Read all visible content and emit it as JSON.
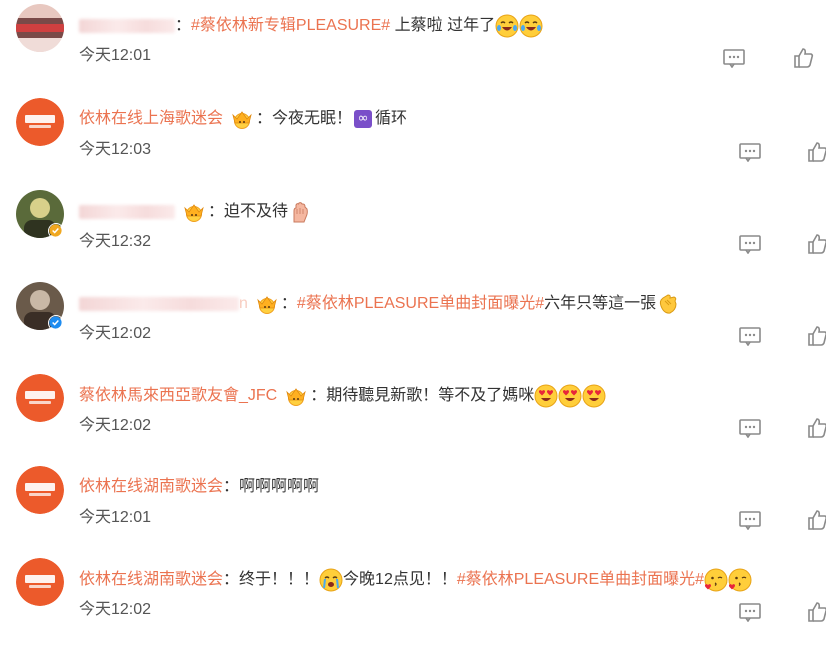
{
  "colors": {
    "accent": "#eb7350",
    "text": "#333333",
    "time": "#555555",
    "icon": "#8a8a8a"
  },
  "comments": [
    {
      "user": {
        "name": "",
        "name_blurred": true,
        "crown": false,
        "verified": false,
        "avatar": "blurred-avatar"
      },
      "colon": "：",
      "content": [
        {
          "type": "hashtag",
          "text": "#蔡依林新专辑PLEASURE#"
        },
        {
          "type": "text",
          "text": " 上蔡啦 过年了"
        },
        {
          "type": "emoji",
          "icon": "tears-of-joy-emoji"
        },
        {
          "type": "emoji",
          "icon": "tears-of-joy-emoji"
        }
      ],
      "time": "今天12:01"
    },
    {
      "user": {
        "name": "依林在线上海歌迷会",
        "name_blurred": false,
        "crown": true,
        "verified": false,
        "avatar": "fanclub-logo-avatar"
      },
      "colon": "：",
      "content": [
        {
          "type": "text",
          "text": "今夜无眠！"
        },
        {
          "type": "symbol",
          "icon": "infinity-icon",
          "text": "∞"
        },
        {
          "type": "text",
          "text": "循环"
        }
      ],
      "time": "今天12:03"
    },
    {
      "user": {
        "name": "",
        "name_blurred": true,
        "crown": true,
        "verified": true,
        "verified_color": "#f0a820",
        "avatar": "photo-avatar"
      },
      "colon": "：",
      "content": [
        {
          "type": "text",
          "text": "迫不及待"
        },
        {
          "type": "emoji",
          "icon": "hand-emoji"
        }
      ],
      "time": "今天12:32"
    },
    {
      "user": {
        "name": "n",
        "name_blurred": true,
        "crown": true,
        "verified": true,
        "verified_color": "#1e8cf0",
        "avatar": "photo-avatar"
      },
      "colon": "：",
      "content": [
        {
          "type": "hashtag",
          "text": "#蔡依林PLEASURE单曲封面曝光#"
        },
        {
          "type": "text",
          "text": "六年只等這一張"
        },
        {
          "type": "emoji",
          "icon": "clapping-hands-emoji"
        }
      ],
      "time": "今天12:02"
    },
    {
      "user": {
        "name": "蔡依林馬來西亞歌友會_JFC",
        "name_blurred": false,
        "crown": true,
        "verified": false,
        "avatar": "fanclub-logo-avatar"
      },
      "colon": "：",
      "content": [
        {
          "type": "text",
          "text": "期待聽見新歌！等不及了媽咪"
        },
        {
          "type": "emoji",
          "icon": "heart-eyes-emoji"
        },
        {
          "type": "emoji",
          "icon": "heart-eyes-emoji"
        },
        {
          "type": "emoji",
          "icon": "heart-eyes-emoji"
        }
      ],
      "time": "今天12:02"
    },
    {
      "user": {
        "name": "依林在线湖南歌迷会",
        "name_blurred": false,
        "crown": false,
        "verified": false,
        "avatar": "fanclub-logo-avatar"
      },
      "colon": "：",
      "content": [
        {
          "type": "text",
          "text": "啊啊啊啊啊"
        }
      ],
      "time": "今天12:01"
    },
    {
      "user": {
        "name": "依林在线湖南歌迷会",
        "name_blurred": false,
        "crown": false,
        "verified": false,
        "avatar": "fanclub-logo-avatar"
      },
      "colon": "：",
      "content": [
        {
          "type": "text",
          "text": "终于！！！"
        },
        {
          "type": "emoji",
          "icon": "crying-emoji"
        },
        {
          "type": "text",
          "text": "今晚12点见！！"
        },
        {
          "type": "hashtag",
          "text": "#蔡依林PLEASURE单曲封面曝光#"
        },
        {
          "type": "emoji",
          "icon": "kissing-heart-emoji"
        },
        {
          "type": "emoji",
          "icon": "kissing-heart-emoji"
        }
      ],
      "time": "今天12:02"
    }
  ]
}
